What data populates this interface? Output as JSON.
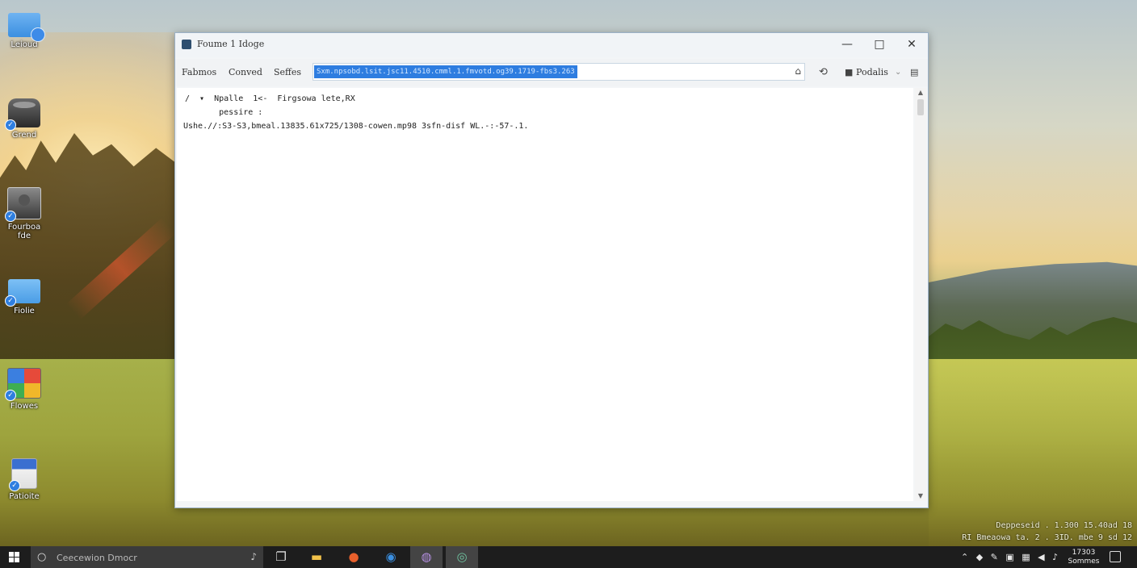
{
  "desktop": {
    "icons": [
      {
        "label": "Leioud"
      },
      {
        "label": "Grend"
      },
      {
        "label": "Fourboa fde"
      },
      {
        "label": "Fiolie"
      },
      {
        "label": "Flowes"
      },
      {
        "label": "Patioite"
      }
    ]
  },
  "window": {
    "title": "Foume 1 Idoge",
    "controls": {
      "minimize": "—",
      "maximize": "□",
      "close": "✕"
    },
    "toolbar": {
      "menu": [
        "Fabmos",
        "Conved",
        "Seffes"
      ],
      "address_selected": "Sxm.npsobd.lsit.jsc11.4510.cmml.1.fmvotd.og39.1719-fbs3.263",
      "profile_label": "Podalis"
    },
    "content": {
      "lines": [
        "/  ▾  Npalle  1<-  Firgsowa lete,RX",
        "       pessire :",
        "Ushe.//:S3-S3,bmeal.13835.61x725/1308-cowen.mp98 3sfn-disf WL.-:-57-.1."
      ]
    }
  },
  "tray_overlay": {
    "line1": "Deppeseid .  1.300 15.40ad 18",
    "line2": "RI  Bmeaowa ta. 2 . 3ID. mbe 9 sd 12"
  },
  "taskbar": {
    "search_placeholder": "Ceecewion Dmocr",
    "clock_time": "17303",
    "clock_date": "Sommes"
  },
  "colors": {
    "selection": "#2e7de0",
    "taskbar": "#1d1d1d",
    "window_border": "#9bb1c7"
  }
}
